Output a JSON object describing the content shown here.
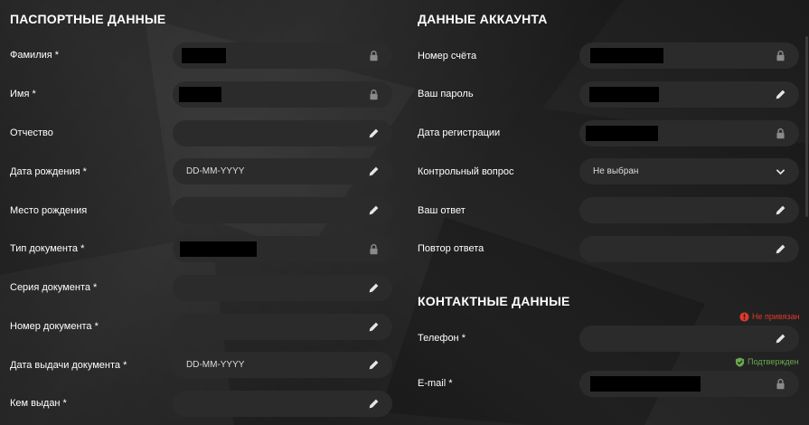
{
  "passport": {
    "title": "ПАСПОРТНЫЕ ДАННЫЕ",
    "fields": [
      {
        "label": "Фамилия *",
        "value": "",
        "redacted": true,
        "icon": "lock-icon"
      },
      {
        "label": "Имя *",
        "value": "",
        "redacted": true,
        "icon": "lock-icon"
      },
      {
        "label": "Отчество",
        "value": "",
        "redacted": false,
        "icon": "pencil-icon"
      },
      {
        "label": "Дата рождения *",
        "value": "DD-MM-YYYY",
        "redacted": false,
        "icon": "pencil-icon"
      },
      {
        "label": "Место рождения",
        "value": "",
        "redacted": false,
        "icon": "pencil-icon"
      },
      {
        "label": "Тип документа *",
        "value": "",
        "redacted": true,
        "icon": "lock-icon"
      },
      {
        "label": "Серия документа *",
        "value": "",
        "redacted": false,
        "icon": "pencil-icon"
      },
      {
        "label": "Номер документа *",
        "value": "",
        "redacted": false,
        "icon": "pencil-icon"
      },
      {
        "label": "Дата выдачи документа *",
        "value": "DD-MM-YYYY",
        "redacted": false,
        "icon": "pencil-icon"
      },
      {
        "label": "Кем выдан *",
        "value": "",
        "redacted": false,
        "icon": "pencil-icon"
      }
    ]
  },
  "account": {
    "title": "ДАННЫЕ АККАУНТА",
    "fields": [
      {
        "label": "Номер счёта",
        "value": "",
        "redacted": true,
        "icon": "lock-icon"
      },
      {
        "label": "Ваш пароль",
        "value": "",
        "redacted": true,
        "icon": "pencil-icon"
      },
      {
        "label": "Дата регистрации",
        "value": "",
        "redacted": true,
        "icon": "lock-icon"
      },
      {
        "label": "Контрольный вопрос",
        "value": "Не выбран",
        "redacted": false,
        "icon": "chevron-down-icon"
      },
      {
        "label": "Ваш ответ",
        "value": "",
        "redacted": false,
        "icon": "pencil-icon"
      },
      {
        "label": "Повтор ответа",
        "value": "",
        "redacted": false,
        "icon": "pencil-icon"
      }
    ]
  },
  "contacts": {
    "title": "КОНТАКТНЫЕ ДАННЫЕ",
    "phone": {
      "label": "Телефон *",
      "status": "Не привязан",
      "status_icon": "error-icon",
      "status_color": "#e0392b",
      "icon": "pencil-icon"
    },
    "email": {
      "label": "E-mail *",
      "status": "Подтвержден",
      "status_icon": "shield-check-icon",
      "status_color": "#6aa84f",
      "redacted": true,
      "icon": "lock-icon"
    }
  }
}
